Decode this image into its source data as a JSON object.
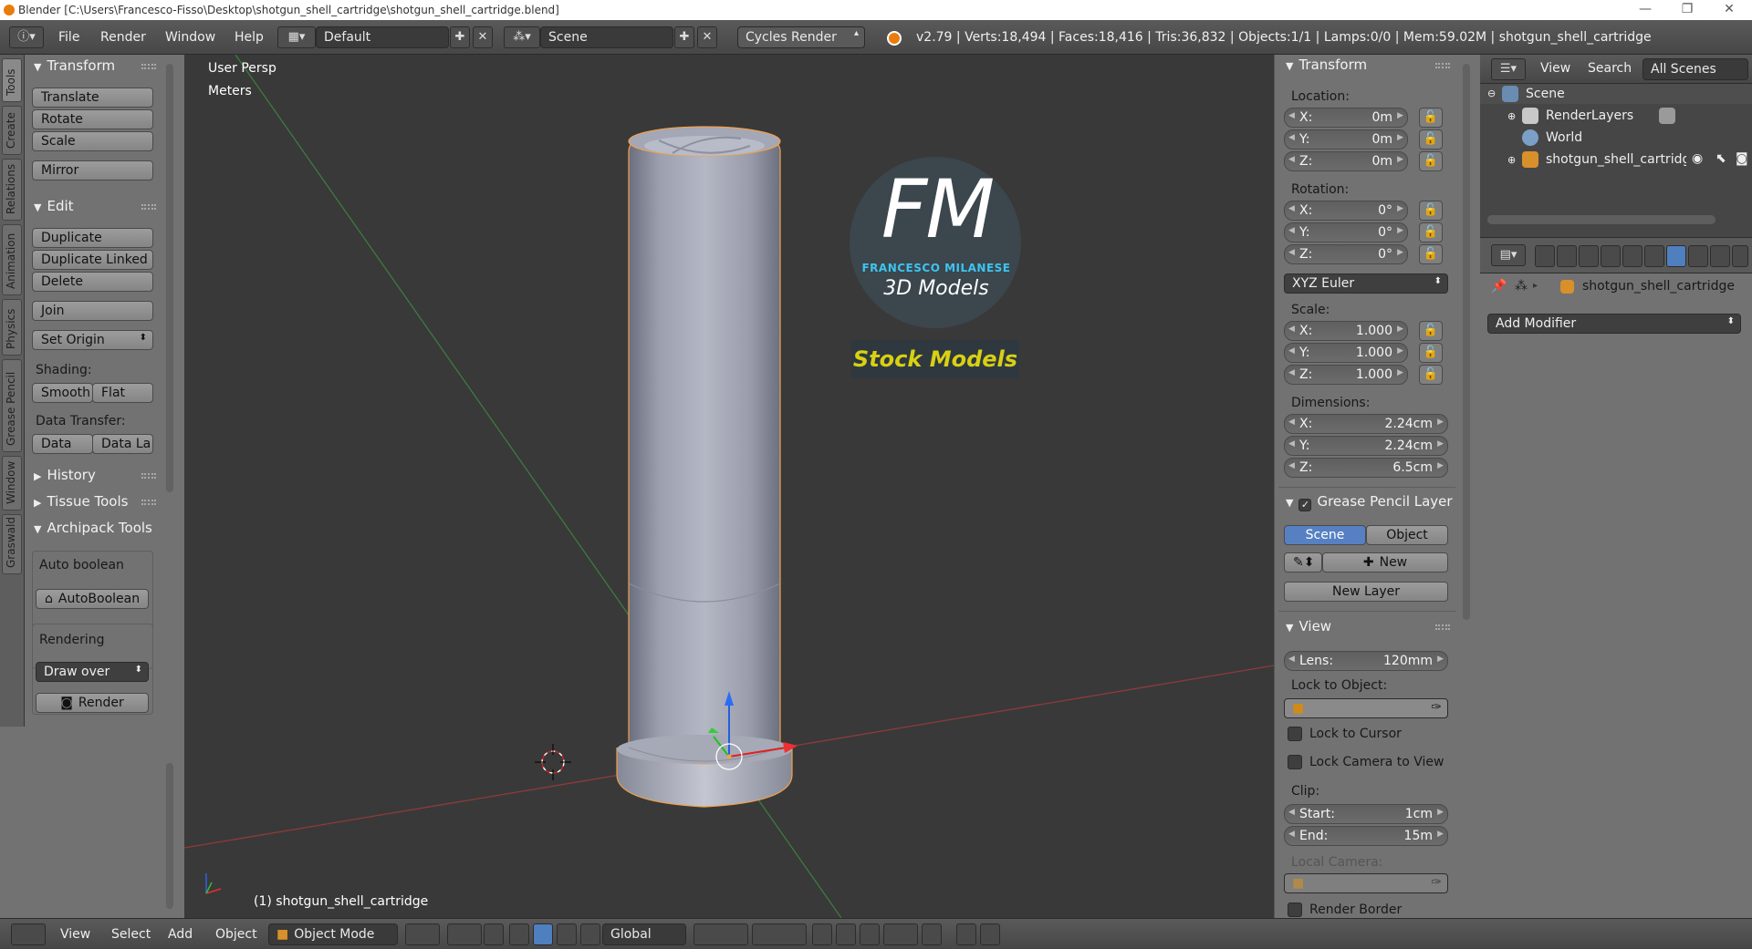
{
  "window": {
    "title": "Blender [C:\\Users\\Francesco-Fisso\\Desktop\\shotgun_shell_cartridge\\shotgun_shell_cartridge.blend]",
    "minimize": "—",
    "maximize": "❐",
    "close": "✕"
  },
  "infobar": {
    "menus": [
      "File",
      "Render",
      "Window",
      "Help"
    ],
    "screen_layout": "Default",
    "scene": "Scene",
    "render_engine": "Cycles Render",
    "stats": "v2.79 | Verts:18,494 | Faces:18,416 | Tris:36,832 | Objects:1/1 | Lamps:0/0 | Mem:59.02M | shotgun_shell_cartridge"
  },
  "left_tabs": [
    "Tools",
    "Create",
    "Relations",
    "Animation",
    "Physics",
    "Grease Pencil",
    "Window",
    "Graswald"
  ],
  "tool_shelf": {
    "transform_header": "Transform",
    "translate": "Translate",
    "rotate": "Rotate",
    "scale": "Scale",
    "mirror": "Mirror",
    "edit_header": "Edit",
    "duplicate": "Duplicate",
    "duplicate_linked": "Duplicate Linked",
    "delete": "Delete",
    "join": "Join",
    "set_origin": "Set Origin",
    "shading_label": "Shading:",
    "smooth": "Smooth",
    "flat": "Flat",
    "data_transfer_label": "Data Transfer:",
    "data": "Data",
    "data_la": "Data La",
    "history": "History",
    "tissue_tools": "Tissue Tools",
    "archipack_tools": "Archipack Tools",
    "auto_boolean_label": "Auto boolean",
    "autoboolean_button": "AutoBoolean",
    "rendering_label": "Rendering",
    "draw_over": "Draw over",
    "render_button": "Render"
  },
  "viewport": {
    "view_name": "User Persp",
    "units": "Meters",
    "object_label": "(1) shotgun_shell_cartridge",
    "watermark_initials": "FM",
    "watermark_name": "FRANCESCO MILANESE",
    "watermark_sub": "3D Models",
    "watermark_banner": "Stock Models"
  },
  "n_panel": {
    "transform_header": "Transform",
    "location_label": "Location:",
    "location": [
      {
        "axis": "X:",
        "value": "0m"
      },
      {
        "axis": "Y:",
        "value": "0m"
      },
      {
        "axis": "Z:",
        "value": "0m"
      }
    ],
    "rotation_label": "Rotation:",
    "rotation": [
      {
        "axis": "X:",
        "value": "0°"
      },
      {
        "axis": "Y:",
        "value": "0°"
      },
      {
        "axis": "Z:",
        "value": "0°"
      }
    ],
    "rotation_mode": "XYZ Euler",
    "scale_label": "Scale:",
    "scale": [
      {
        "axis": "X:",
        "value": "1.000"
      },
      {
        "axis": "Y:",
        "value": "1.000"
      },
      {
        "axis": "Z:",
        "value": "1.000"
      }
    ],
    "dimensions_label": "Dimensions:",
    "dimensions": [
      {
        "axis": "X:",
        "value": "2.24cm"
      },
      {
        "axis": "Y:",
        "value": "2.24cm"
      },
      {
        "axis": "Z:",
        "value": "6.5cm"
      }
    ],
    "grease_pencil_header": "Grease Pencil Layer",
    "scene_tab": "Scene",
    "object_tab": "Object",
    "new_button": "New",
    "new_layer_button": "New Layer",
    "view_header": "View",
    "lens_label": "Lens:",
    "lens_value": "120mm",
    "lock_to_object_label": "Lock to Object:",
    "lock_to_cursor": "Lock to Cursor",
    "lock_camera_to_view": "Lock Camera to View",
    "clip_label": "Clip:",
    "clip_start_label": "Start:",
    "clip_start_value": "1cm",
    "clip_end_label": "End:",
    "clip_end_value": "15m",
    "local_camera_label": "Local Camera:",
    "render_border": "Render Border"
  },
  "outliner": {
    "view_menu": "View",
    "search_menu": "Search",
    "display_mode": "All Scenes",
    "items": [
      "Scene",
      "RenderLayers",
      "World",
      "shotgun_shell_cartridge"
    ]
  },
  "properties": {
    "object_name": "shotgun_shell_cartridge",
    "add_modifier": "Add Modifier"
  },
  "bottom_bar": {
    "menus": [
      "View",
      "Select",
      "Add",
      "Object"
    ],
    "mode": "Object Mode",
    "orientation": "Global"
  },
  "colors": {
    "accent_blue": "#5680c2",
    "selection_orange": "#f1a14b",
    "watermark_cyan": "#3ec4f0",
    "watermark_yellow": "#d8d012"
  }
}
